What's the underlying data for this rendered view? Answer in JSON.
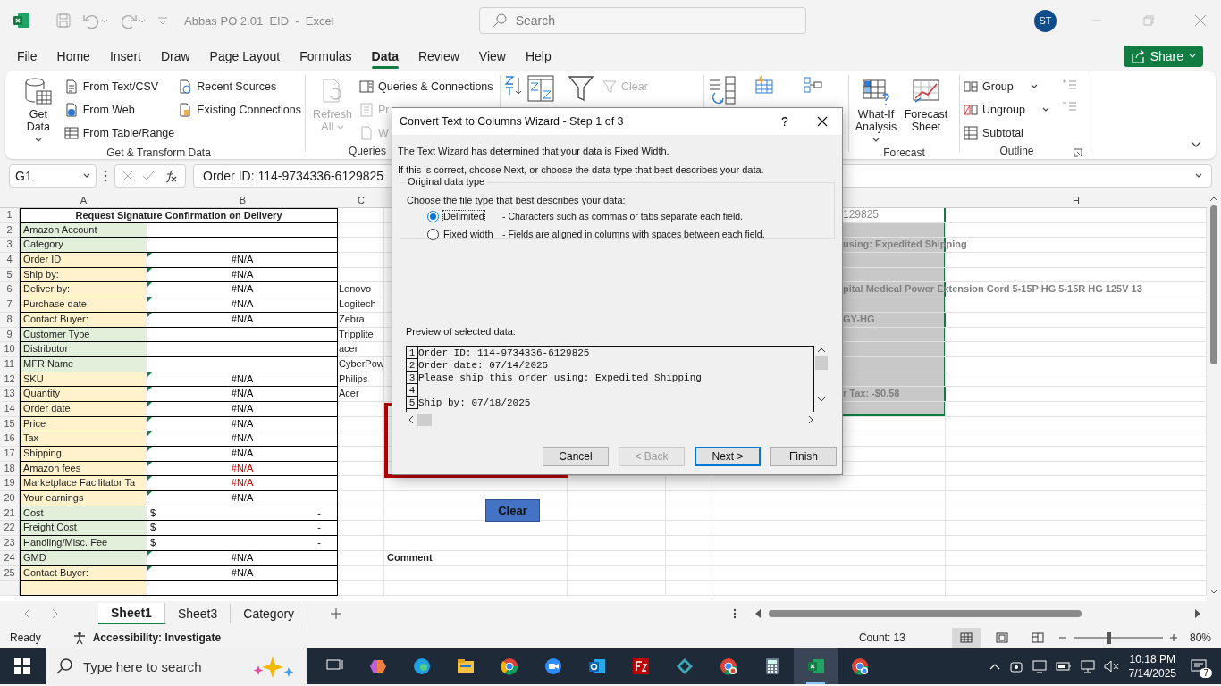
{
  "window": {
    "title": "Abbas PO 2.01  EID  -  Excel",
    "search_placeholder": "Search",
    "user_initials": "ST"
  },
  "menu_tabs": [
    {
      "label": "File",
      "selected": false
    },
    {
      "label": "Home",
      "selected": false
    },
    {
      "label": "Insert",
      "selected": false
    },
    {
      "label": "Draw",
      "selected": false
    },
    {
      "label": "Page Layout",
      "selected": false
    },
    {
      "label": "Formulas",
      "selected": false
    },
    {
      "label": "Data",
      "selected": true
    },
    {
      "label": "Review",
      "selected": false
    },
    {
      "label": "View",
      "selected": false
    },
    {
      "label": "Help",
      "selected": false
    }
  ],
  "share_button": "Share",
  "ribbon_groups": [
    {
      "kind": "standard",
      "label": "Get & Transform Data",
      "large": [
        {
          "label": "Get Data",
          "disabled": false,
          "caret": true
        }
      ],
      "small": [
        [
          {
            "label": "From Text/CSV",
            "disabled": false,
            "caret": false
          },
          {
            "label": "From Web",
            "disabled": false,
            "caret": false
          },
          {
            "label": "From Table/Range",
            "disabled": false,
            "caret": false
          }
        ],
        [
          {
            "label": "Recent Sources",
            "disabled": false,
            "caret": false
          },
          {
            "label": "Existing Connections",
            "disabled": false,
            "caret": false
          }
        ]
      ]
    },
    {
      "kind": "standard",
      "label": "Queries",
      "large": [
        {
          "label": "Refresh All",
          "disabled": true,
          "caret": true
        }
      ],
      "small": [
        [
          {
            "label": "Queries & Connections",
            "disabled": false,
            "caret": false
          },
          {
            "label": "Pr",
            "disabled": true,
            "caret": false
          },
          {
            "label": "W",
            "disabled": true,
            "caret": false
          }
        ]
      ]
    },
    {
      "kind": "sort_filter",
      "small": [
        [
          {
            "label": "Clear",
            "disabled": true,
            "caret": false
          }
        ]
      ]
    },
    {
      "kind": "data_tools"
    },
    {
      "kind": "standard",
      "label": "Forecast",
      "large": [
        {
          "label": "What-If Analysis",
          "disabled": false,
          "caret": true
        },
        {
          "label": "Forecast Sheet",
          "disabled": false,
          "caret": false
        }
      ]
    },
    {
      "kind": "outline",
      "label": "Outline",
      "small": [
        [
          {
            "label": "Group",
            "disabled": false,
            "caret": true
          },
          {
            "label": "Ungroup",
            "disabled": false,
            "caret": true
          },
          {
            "label": "Subtotal",
            "disabled": false,
            "caret": false
          }
        ]
      ]
    }
  ],
  "formula_bar": {
    "name_box": "G1",
    "formula": "Order ID: 114-9734336-6129825"
  },
  "column_headers": [
    "A",
    "B",
    "C",
    "H"
  ],
  "rows": [
    {
      "number": "1",
      "kind": "title",
      "a": "Request Signature Confirmation on Delivery",
      "g": "129825",
      "g_selected": true,
      "g_active": true
    },
    {
      "number": "2",
      "kind": "field",
      "a": "Amazon Account",
      "color": "#e2efda",
      "b_flag": false,
      "g_selected": true,
      "g_active": false
    },
    {
      "number": "3",
      "kind": "field",
      "a": "Category",
      "color": "#e2efda",
      "b_flag": false,
      "g": "using: Expedited Shipping",
      "g_selected": true,
      "g_active": false
    },
    {
      "number": "4",
      "kind": "field",
      "a": "Order ID",
      "color": "#fff2cc",
      "b": "#N/A",
      "b_error": false,
      "b_flag": true,
      "g_selected": true,
      "g_active": false
    },
    {
      "number": "5",
      "kind": "field",
      "a": "Ship by:",
      "color": "#fff2cc",
      "b": "#N/A",
      "b_error": false,
      "b_flag": true,
      "g_selected": true,
      "g_active": false
    },
    {
      "number": "6",
      "kind": "field",
      "a": "Deliver by:",
      "color": "#fff2cc",
      "b": "#N/A",
      "b_error": false,
      "b_flag": true,
      "c": "Lenovo",
      "g": "pital Medical Power Extension Cord 5-15P HG 5-15R HG 125V 13",
      "g_selected": true,
      "g_active": false
    },
    {
      "number": "7",
      "kind": "field",
      "a": "Purchase date:",
      "color": "#fff2cc",
      "b": "#N/A",
      "b_error": false,
      "b_flag": true,
      "c": "Logitech",
      "g_selected": true,
      "g_active": false
    },
    {
      "number": "8",
      "kind": "field",
      "a": "Contact Buyer:",
      "color": "#fff2cc",
      "b": "#N/A",
      "b_error": false,
      "b_flag": true,
      "c": "Zebra",
      "g": "GY-HG",
      "g_selected": true,
      "g_active": false
    },
    {
      "number": "9",
      "kind": "field",
      "a": "Customer Type",
      "color": "#e2efda",
      "b_flag": false,
      "c": "Tripplite",
      "g_selected": true,
      "g_active": false
    },
    {
      "number": "10",
      "kind": "field",
      "a": "Distributor",
      "color": "#e2efda",
      "b_flag": false,
      "c": "acer",
      "g_selected": true,
      "g_active": false
    },
    {
      "number": "11",
      "kind": "field",
      "a": "MFR Name",
      "color": "#e2efda",
      "b_flag": false,
      "c": "CyberPow",
      "g_selected": true,
      "g_active": false
    },
    {
      "number": "12",
      "kind": "field",
      "a": "SKU",
      "color": "#fff2cc",
      "b": "#N/A",
      "b_error": false,
      "b_flag": true,
      "c": "Philips",
      "g_selected": true,
      "g_active": false
    },
    {
      "number": "13",
      "kind": "field",
      "a": "Quantity",
      "color": "#fff2cc",
      "b": "#N/A",
      "b_error": false,
      "b_flag": true,
      "c": "Acer",
      "g": "r Tax: -$0.58",
      "g_selected": true,
      "g_active": false
    },
    {
      "number": "14",
      "kind": "field",
      "a": "Order date",
      "color": "#fff2cc",
      "b": "#N/A",
      "b_error": false,
      "b_flag": true,
      "g_selected": true,
      "g_active": false
    },
    {
      "number": "15",
      "kind": "field",
      "a": "Price",
      "color": "#fff2cc",
      "b": "#N/A",
      "b_error": false,
      "b_flag": true,
      "g_selected": false,
      "g_active": false
    },
    {
      "number": "16",
      "kind": "field",
      "a": "Tax",
      "color": "#fff2cc",
      "b": "#N/A",
      "b_error": false,
      "b_flag": true,
      "g_selected": false,
      "g_active": false
    },
    {
      "number": "17",
      "kind": "field",
      "a": "Shipping",
      "color": "#fff2cc",
      "b": "#N/A",
      "b_error": false,
      "b_flag": true,
      "g_selected": false,
      "g_active": false
    },
    {
      "number": "18",
      "kind": "field",
      "a": "Amazon fees",
      "color": "#fff2cc",
      "b": "#N/A",
      "b_error": true,
      "b_flag": true,
      "g_selected": false,
      "g_active": false
    },
    {
      "number": "19",
      "kind": "field",
      "a": "Marketplace Facilitator Ta",
      "color": "#fff2cc",
      "b": "#N/A",
      "b_error": true,
      "b_flag": true,
      "g_selected": false,
      "g_active": false
    },
    {
      "number": "20",
      "kind": "field",
      "a": "Your earnings",
      "color": "#fff2cc",
      "b": "#N/A",
      "b_error": false,
      "b_flag": true,
      "g_selected": false,
      "g_active": false
    },
    {
      "number": "21",
      "kind": "field",
      "a": "Cost",
      "color": "#e2efda",
      "b": "$",
      "b_end": "-",
      "b_error": false,
      "b_flag": false,
      "g_selected": false,
      "g_active": false
    },
    {
      "number": "22",
      "kind": "field",
      "a": "Freight Cost",
      "color": "#e2efda",
      "b": "$",
      "b_end": "-",
      "b_error": false,
      "b_flag": false,
      "g_selected": false,
      "g_active": false
    },
    {
      "number": "23",
      "kind": "field",
      "a": "Handling/Misc. Fee",
      "color": "#e2efda",
      "b": "$",
      "b_end": "-",
      "b_error": false,
      "b_flag": false,
      "g_selected": false,
      "g_active": false
    },
    {
      "number": "24",
      "kind": "field",
      "a": "GMD",
      "color": "#e2efda",
      "b": "#N/A",
      "b_error": false,
      "b_flag": true,
      "d": "Comment",
      "g_selected": false,
      "g_active": false
    },
    {
      "number": "25",
      "kind": "field",
      "a": "Contact Buyer:",
      "color": "#fff2cc",
      "b": "#N/A",
      "b_error": false,
      "b_flag": true,
      "g_selected": false,
      "g_active": false
    },
    {
      "kind": "field",
      "color": "#fff2cc",
      "b_flag": false,
      "g_selected": false,
      "g_active": false
    }
  ],
  "clear_button": "Clear",
  "dialog": {
    "title": "Convert Text to Columns Wizard - Step 1 of 3",
    "help": "?",
    "intro": [
      "The Text Wizard has determined that your data is Fixed Width.",
      "If this is correct, choose Next, or choose the data type that best describes your data."
    ],
    "group_title": "Original data type",
    "prompt": "Choose the file type that best describes your data:",
    "options": [
      {
        "label": "Delimited",
        "description": "- Characters such as commas or tabs separate each field.",
        "selected": true
      },
      {
        "label": "Fixed width",
        "description": "- Fields are aligned in columns with spaces between each field.",
        "selected": false
      }
    ],
    "preview_label": "Preview of selected data:",
    "preview_lines": [
      {
        "number": "1",
        "text": "Order ID: 114-9734336-6129825"
      },
      {
        "number": "2",
        "text": "Order date: 07/14/2025"
      },
      {
        "number": "3",
        "text": "Please ship this order using: Expedited Shipping"
      },
      {
        "number": "4"
      },
      {
        "number": "5",
        "text": "Ship by: 07/18/2025"
      }
    ],
    "buttons": [
      {
        "label": "Cancel",
        "disabled": false,
        "default": false
      },
      {
        "label": "< Back",
        "disabled": true,
        "default": false
      },
      {
        "label": "Next >",
        "disabled": false,
        "default": true
      },
      {
        "label": "Finish",
        "disabled": false,
        "default": false
      }
    ]
  },
  "sheet_tabs": [
    {
      "label": "Sheet1",
      "selected": true
    },
    {
      "label": "Sheet3",
      "selected": false
    },
    {
      "label": "Category",
      "selected": false
    }
  ],
  "status_bar": {
    "ready": "Ready",
    "accessibility": "Accessibility: Investigate",
    "count": "Count: 13",
    "zoom": "80%",
    "level": 0.4
  },
  "taskbar": {
    "search_placeholder": "Type here to search",
    "apps": [
      {
        "selected": false
      },
      {
        "selected": false
      },
      {
        "selected": false
      },
      {
        "selected": false
      },
      {
        "selected": false
      },
      {
        "selected": false
      },
      {
        "selected": false
      },
      {
        "selected": false
      },
      {
        "selected": false
      },
      {
        "selected": false
      },
      {
        "selected": false
      },
      {
        "selected": true
      },
      {
        "selected": false
      }
    ],
    "time": "10:18 PM",
    "date": "7/14/2025",
    "notifications": "7"
  }
}
